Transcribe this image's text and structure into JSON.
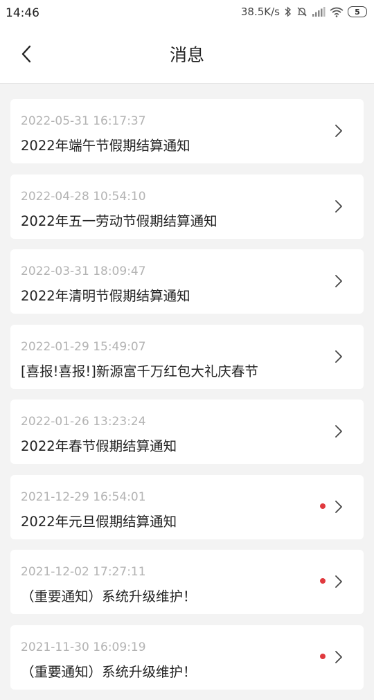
{
  "status_bar": {
    "time": "14:46",
    "net_speed": "38.5K/s",
    "battery": "5",
    "icons": [
      "bluetooth-icon",
      "mute-icon",
      "signal-icon",
      "wifi-icon",
      "battery-icon"
    ]
  },
  "header": {
    "title": "消息",
    "back_icon": "chevron-left-icon"
  },
  "messages": [
    {
      "date": "2022-05-31 16:17:37",
      "title": "2022年端午节假期结算通知",
      "unread": false
    },
    {
      "date": "2022-04-28 10:54:10",
      "title": "2022年五一劳动节假期结算通知",
      "unread": false
    },
    {
      "date": "2022-03-31 18:09:47",
      "title": "2022年清明节假期结算通知",
      "unread": false
    },
    {
      "date": "2022-01-29 15:49:07",
      "title": "[喜报!喜报!]新源富千万红包大礼庆春节",
      "unread": false
    },
    {
      "date": "2022-01-26 13:23:24",
      "title": "2022年春节假期结算通知",
      "unread": false
    },
    {
      "date": "2021-12-29 16:54:01",
      "title": "2022年元旦假期结算通知",
      "unread": true
    },
    {
      "date": "2021-12-02 17:27:11",
      "title": "（重要通知）系统升级维护！",
      "unread": true
    },
    {
      "date": "2021-11-30 16:09:19",
      "title": "（重要通知）系统升级维护！",
      "unread": true
    }
  ],
  "colors": {
    "background": "#f3f3f3",
    "card": "#ffffff",
    "unread_dot": "#e0393e",
    "date_text": "#b3b3b3"
  }
}
